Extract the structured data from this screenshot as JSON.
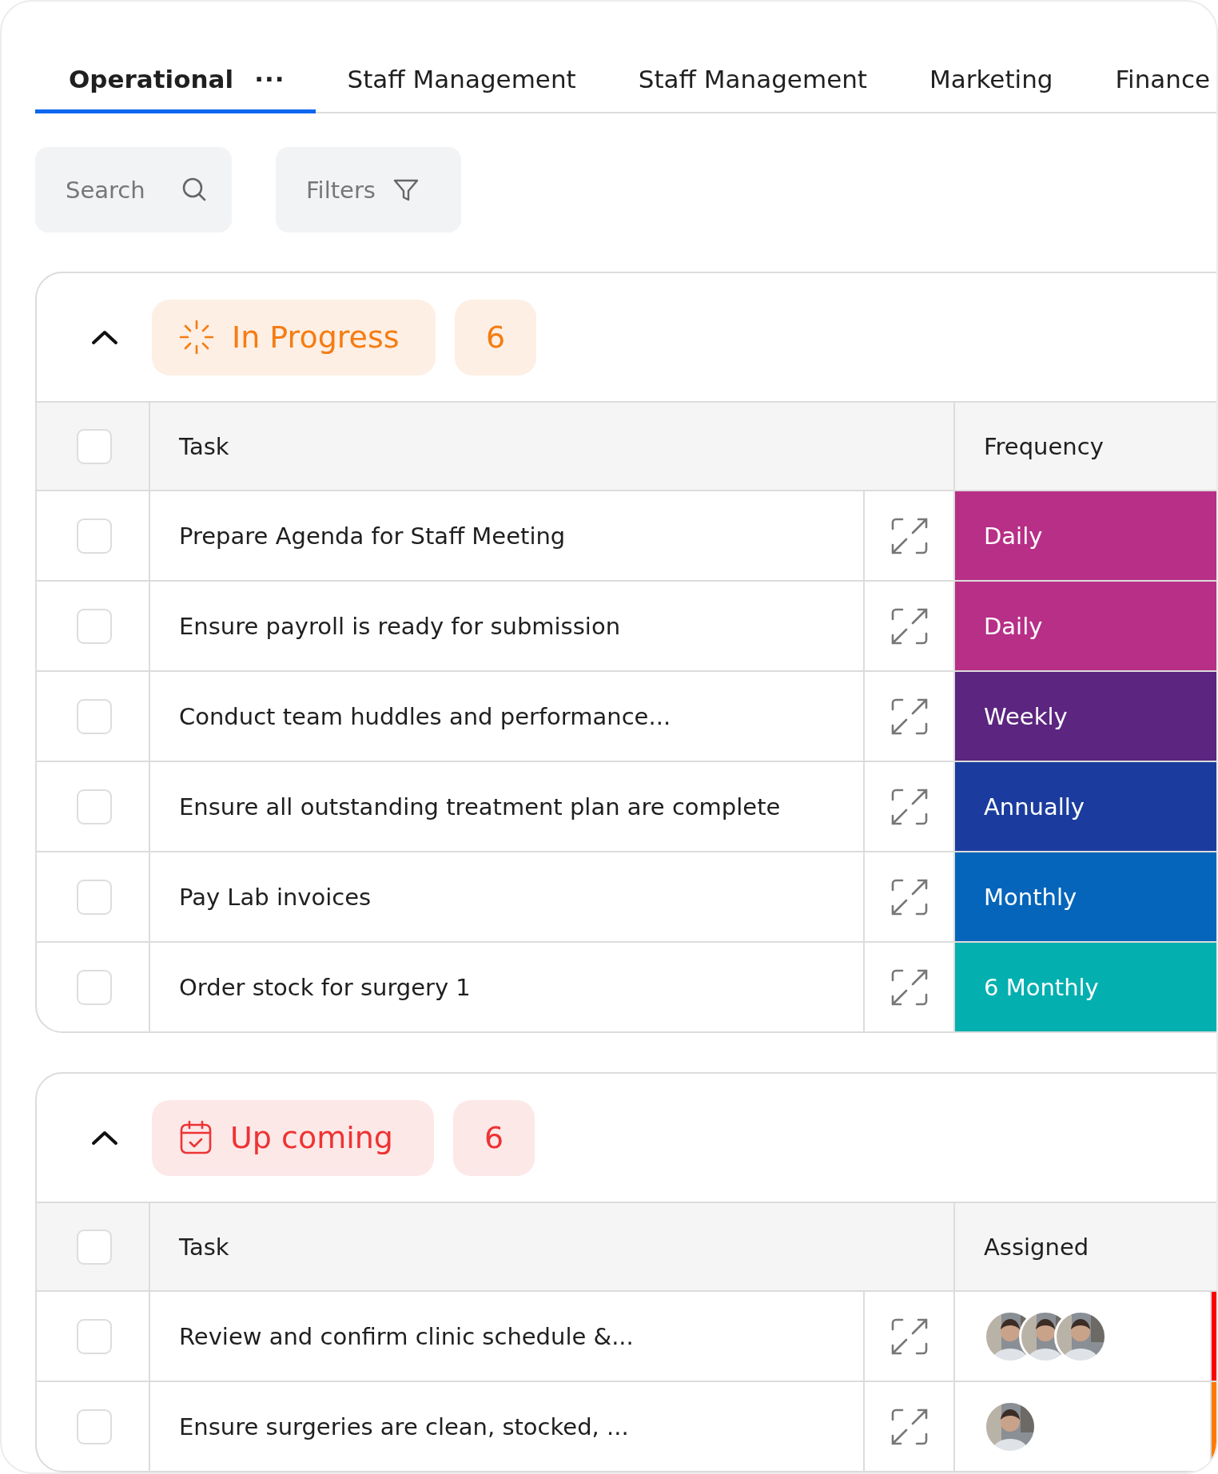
{
  "tabs": [
    {
      "label": "Operational",
      "selected": true,
      "more": "···"
    },
    {
      "label": "Staff Management",
      "selected": false
    },
    {
      "label": "Staff Management",
      "selected": false
    },
    {
      "label": "Marketing",
      "selected": false
    },
    {
      "label": "Finance",
      "selected": false
    }
  ],
  "toolbar": {
    "search": {
      "placeholder": "Search"
    },
    "filters": {
      "label": "Filters"
    }
  },
  "groups": [
    {
      "kind": "in_progress",
      "status": "In Progress",
      "count": "6",
      "expanded": true,
      "all_checked": false,
      "columns": [
        "Task",
        "Frequency"
      ],
      "rows": [
        {
          "task": "Prepare Agenda for Staff Meeting",
          "checked": false,
          "frequency": "Daily",
          "color": "#b72f87"
        },
        {
          "task": "Ensure payroll is ready for submission",
          "checked": false,
          "frequency": "Daily",
          "color": "#b72f87"
        },
        {
          "task": "Conduct team huddles and performance...",
          "checked": false,
          "frequency": "Weekly",
          "color": "#5b2580"
        },
        {
          "task": "Ensure all  outstanding treatment plan  are complete",
          "checked": false,
          "frequency": "Annually",
          "color": "#1b3c9e"
        },
        {
          "task": "Pay Lab invoices",
          "checked": false,
          "frequency": "Monthly",
          "color": "#0465bb"
        },
        {
          "task": "Order stock for surgery 1",
          "checked": false,
          "frequency": "6 Monthly",
          "color": "#03afaf"
        }
      ]
    },
    {
      "kind": "upcoming",
      "status": "Up coming",
      "count": "6",
      "expanded": true,
      "all_checked": false,
      "columns": [
        "Task",
        "Assigned"
      ],
      "rows": [
        {
          "task": "Review and confirm clinic schedule &...",
          "checked": false,
          "color": "#ff0000"
        },
        {
          "task": "Ensure surgeries are clean, stocked, ...",
          "checked": false,
          "color": "#ff7a00"
        }
      ]
    }
  ]
}
